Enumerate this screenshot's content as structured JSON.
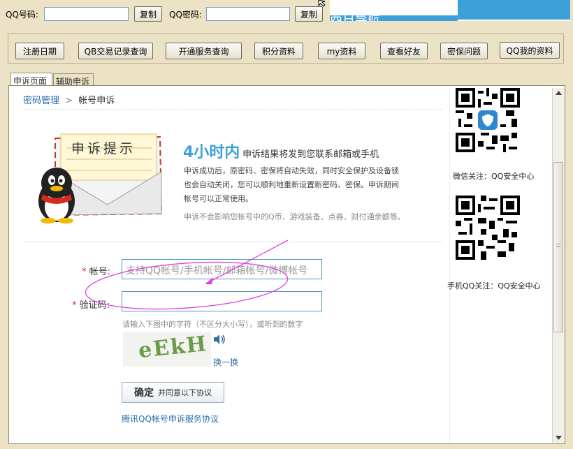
{
  "toolbar": {
    "qq_label": "QQ号码:",
    "qq_value": "",
    "copy1": "复制",
    "pwd_label": "QQ密码:",
    "pwd_value": "",
    "copy2": "复制",
    "banner_text": "西日导航"
  },
  "actions": [
    "注册日期",
    "QB交易记录查询",
    "开通服务查询",
    "积分资料",
    "my资料",
    "查看好友",
    "密保问题",
    "QQ我的资料"
  ],
  "tabs": [
    "申诉页面",
    "辅助申诉"
  ],
  "breadcrumb": {
    "parent": "密码管理",
    "sep": ">",
    "current": "帐号申诉"
  },
  "notice": {
    "envelope_text": "申诉提示",
    "headline": "4小时内",
    "headline_rest": "申诉结果将发到您联系邮箱或手机",
    "line1": "申诉成功后，原密码、密保将自动失效，同时安全保护及设备锁",
    "line2": "也会自动关闭，您可以顺利地重新设置新密码、密保。申诉期间",
    "line3": "帐号可以正常使用。",
    "note": "申诉不会影响您帐号中的Q币、游戏装备、点券、财付通余额等。"
  },
  "form": {
    "account_star": "*",
    "account_label": "帐号:",
    "account_placeholder": "支持QQ帐号/手机帐号/邮箱帐号/微博帐号",
    "captcha_star": "*",
    "captcha_label": "验证码:",
    "captcha_hint": "请输入下图中的字符（不区分大小写），或听到的数字",
    "captcha_text": "eEkH",
    "refresh": "换一换",
    "submit_main": "确定",
    "submit_sub": "并同意以下协议",
    "agreement": "腾讯QQ帐号申诉服务协议"
  },
  "sidebar": {
    "wechat_caption": "微信关注：QQ安全中心",
    "mobile_caption": "手机QQ关注：QQ安全中心"
  },
  "colors": {
    "accent": "#3ea0d8",
    "brand_blue": "#2d6fa8",
    "annotation": "#e040e0",
    "window_bg": "#ece2c6"
  }
}
